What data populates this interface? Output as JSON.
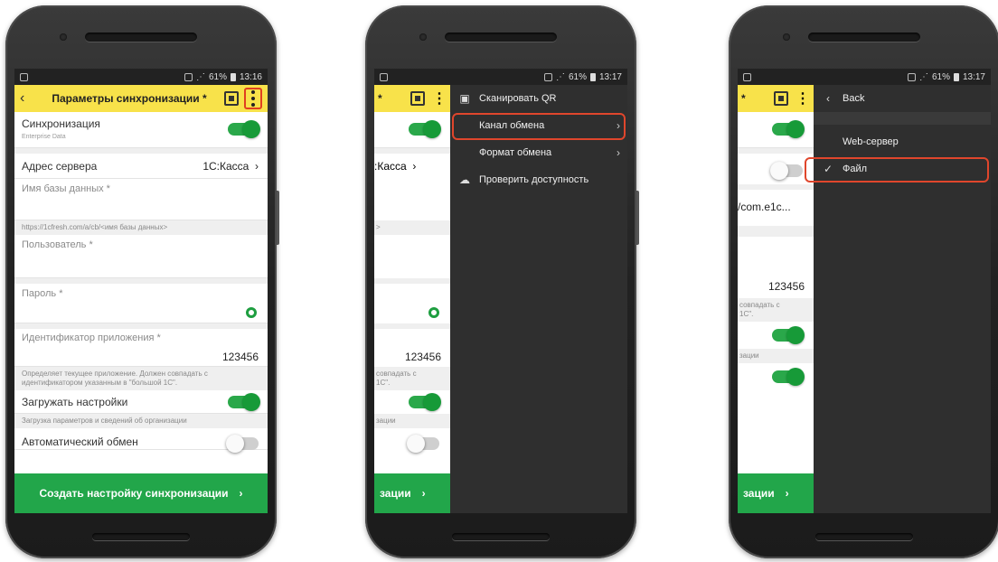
{
  "status": {
    "time1": "13:16",
    "time2": "13:17",
    "time3": "13:17",
    "battery": "61%"
  },
  "form": {
    "title": "Параметры синхронизации *",
    "sync_label": "Синхронизация",
    "sync_sub": "Enterprise Data",
    "server_label": "Адрес сервера",
    "server_value": "1С:Касса",
    "db_label": "Имя базы данных *",
    "db_hint": "https://1cfresh.com/a/cb/<имя базы данных>",
    "user_label": "Пользователь *",
    "password_label": "Пароль *",
    "app_id_label": "Идентификатор приложения *",
    "app_id_value": "123456",
    "app_id_hint": "Определяет текущее приложение. Должен совпадать с идентификатором указанным в \"большой 1С\".",
    "load_label": "Загружать настройки",
    "load_hint": "Загрузка параметров и сведений об организации",
    "auto_label": "Автоматический обмен",
    "create_button": "Создать настройку синхронизации"
  },
  "screen2": {
    "title_frag": "* ",
    "server_frag": ":Касса",
    "hint_frag": ">",
    "app_id_value": "123456",
    "app_hint_frag1": "совпадать с",
    "app_hint_frag2": "1С\".",
    "load_hint_frag": "зации",
    "button_frag": "зации",
    "menu": [
      {
        "label": "Сканировать QR",
        "icon": "qr-icon"
      },
      {
        "label": "Канал обмена",
        "icon": ""
      },
      {
        "label": "Формат обмена",
        "icon": ""
      },
      {
        "label": "Проверить доступность",
        "icon": "cloud-icon"
      }
    ]
  },
  "screen3": {
    "title_frag": "* ",
    "path_frag": "/com.e1c...",
    "app_id_value": "123456",
    "app_hint_frag1": "совпадать с",
    "app_hint_frag2": "1С\".",
    "load_hint_frag": "зации",
    "button_frag": "зации",
    "back_label": "Back",
    "option_web": "Web-сервер",
    "option_file": "Файл"
  },
  "colors": {
    "appbar": "#f8e24a",
    "accent_green": "#22a64a",
    "menu_bg": "#2f2f2f",
    "highlight": "#e0462c"
  }
}
